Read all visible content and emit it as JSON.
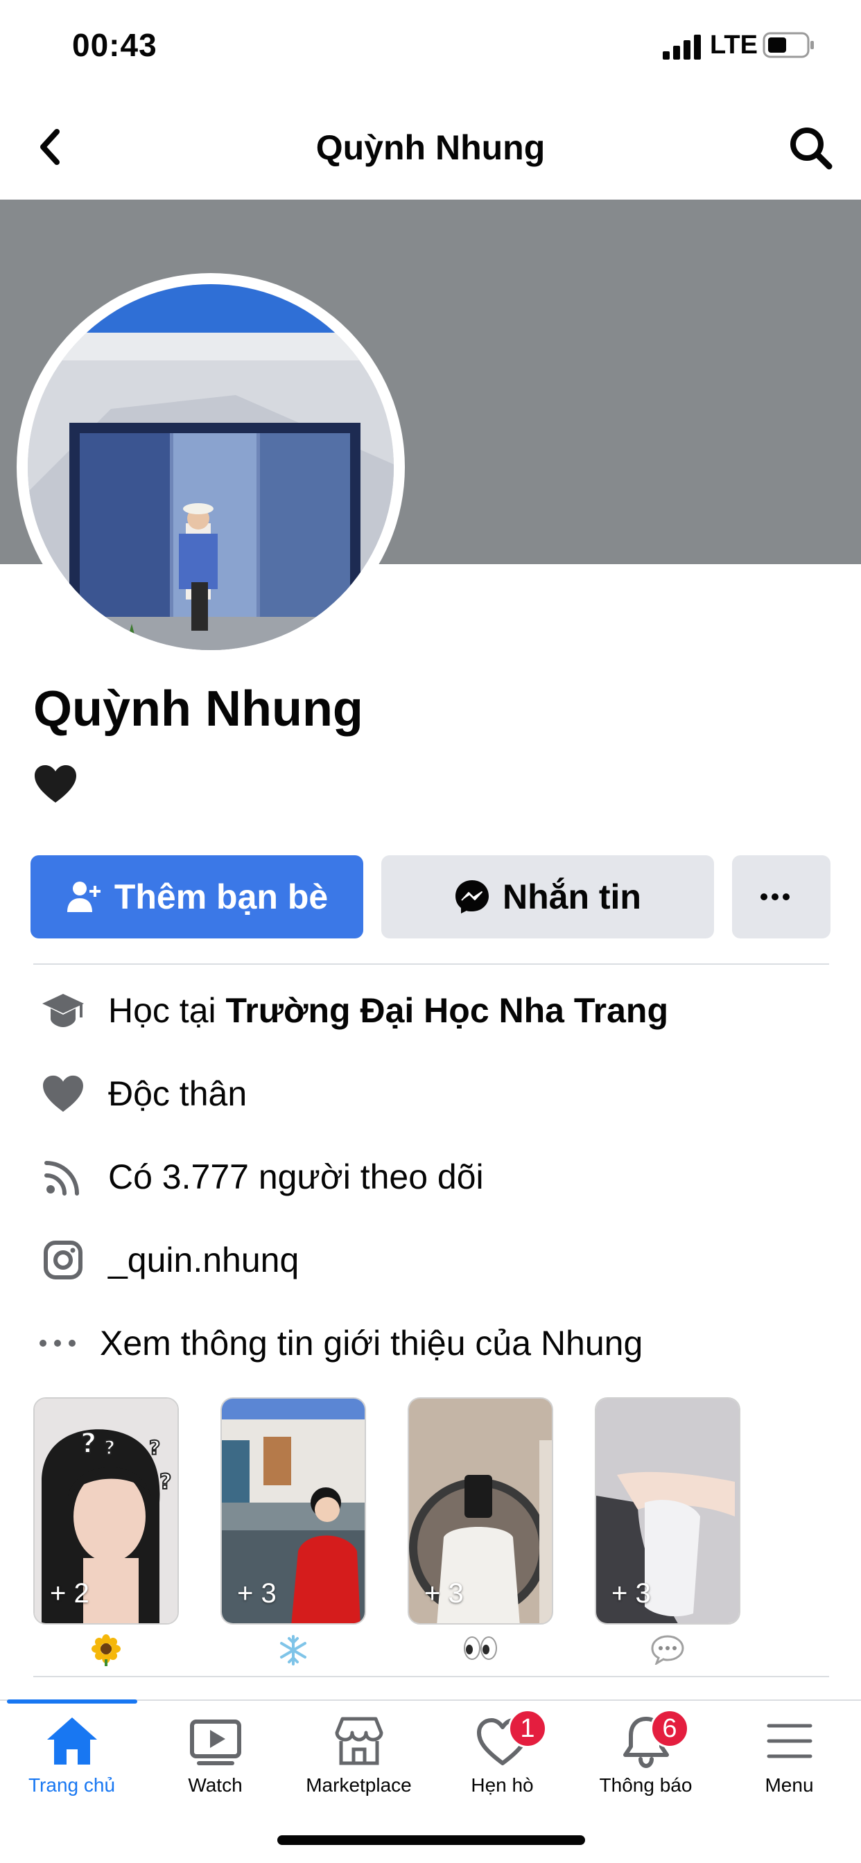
{
  "status_bar": {
    "time": "00:43",
    "network": "LTE"
  },
  "header": {
    "title": "Quỳnh Nhung"
  },
  "profile": {
    "name": "Quỳnh Nhung",
    "bio_emoji": "black-heart-icon"
  },
  "actions": {
    "add_friend": "Thêm bạn bè",
    "message": "Nhắn tin",
    "more": "more-icon"
  },
  "info": {
    "study_prefix": "Học tại ",
    "study_school": "Trường Đại Học Nha Trang",
    "relationship": "Độc thân",
    "followers": "Có 3.777 người theo dõi",
    "instagram": "_quin.nhunq",
    "see_about": "Xem thông tin giới thiệu của Nhung"
  },
  "highlights": [
    {
      "count": "+ 2",
      "emoji": "🌻"
    },
    {
      "count": "+ 3",
      "emoji": "❄️"
    },
    {
      "count": "+ 3",
      "emoji": "👀"
    },
    {
      "count": "+ 3",
      "emoji": "💬"
    }
  ],
  "tabs": [
    {
      "label": "Trang chủ",
      "active": true
    },
    {
      "label": "Watch"
    },
    {
      "label": "Marketplace"
    },
    {
      "label": "Hẹn hò",
      "badge": "1"
    },
    {
      "label": "Thông báo",
      "badge": "6"
    },
    {
      "label": "Menu"
    }
  ],
  "colors": {
    "accent": "#1877f2",
    "add_friend_button": "#3b78e7",
    "cover": "#868a8d",
    "badge": "#e41e3f"
  }
}
